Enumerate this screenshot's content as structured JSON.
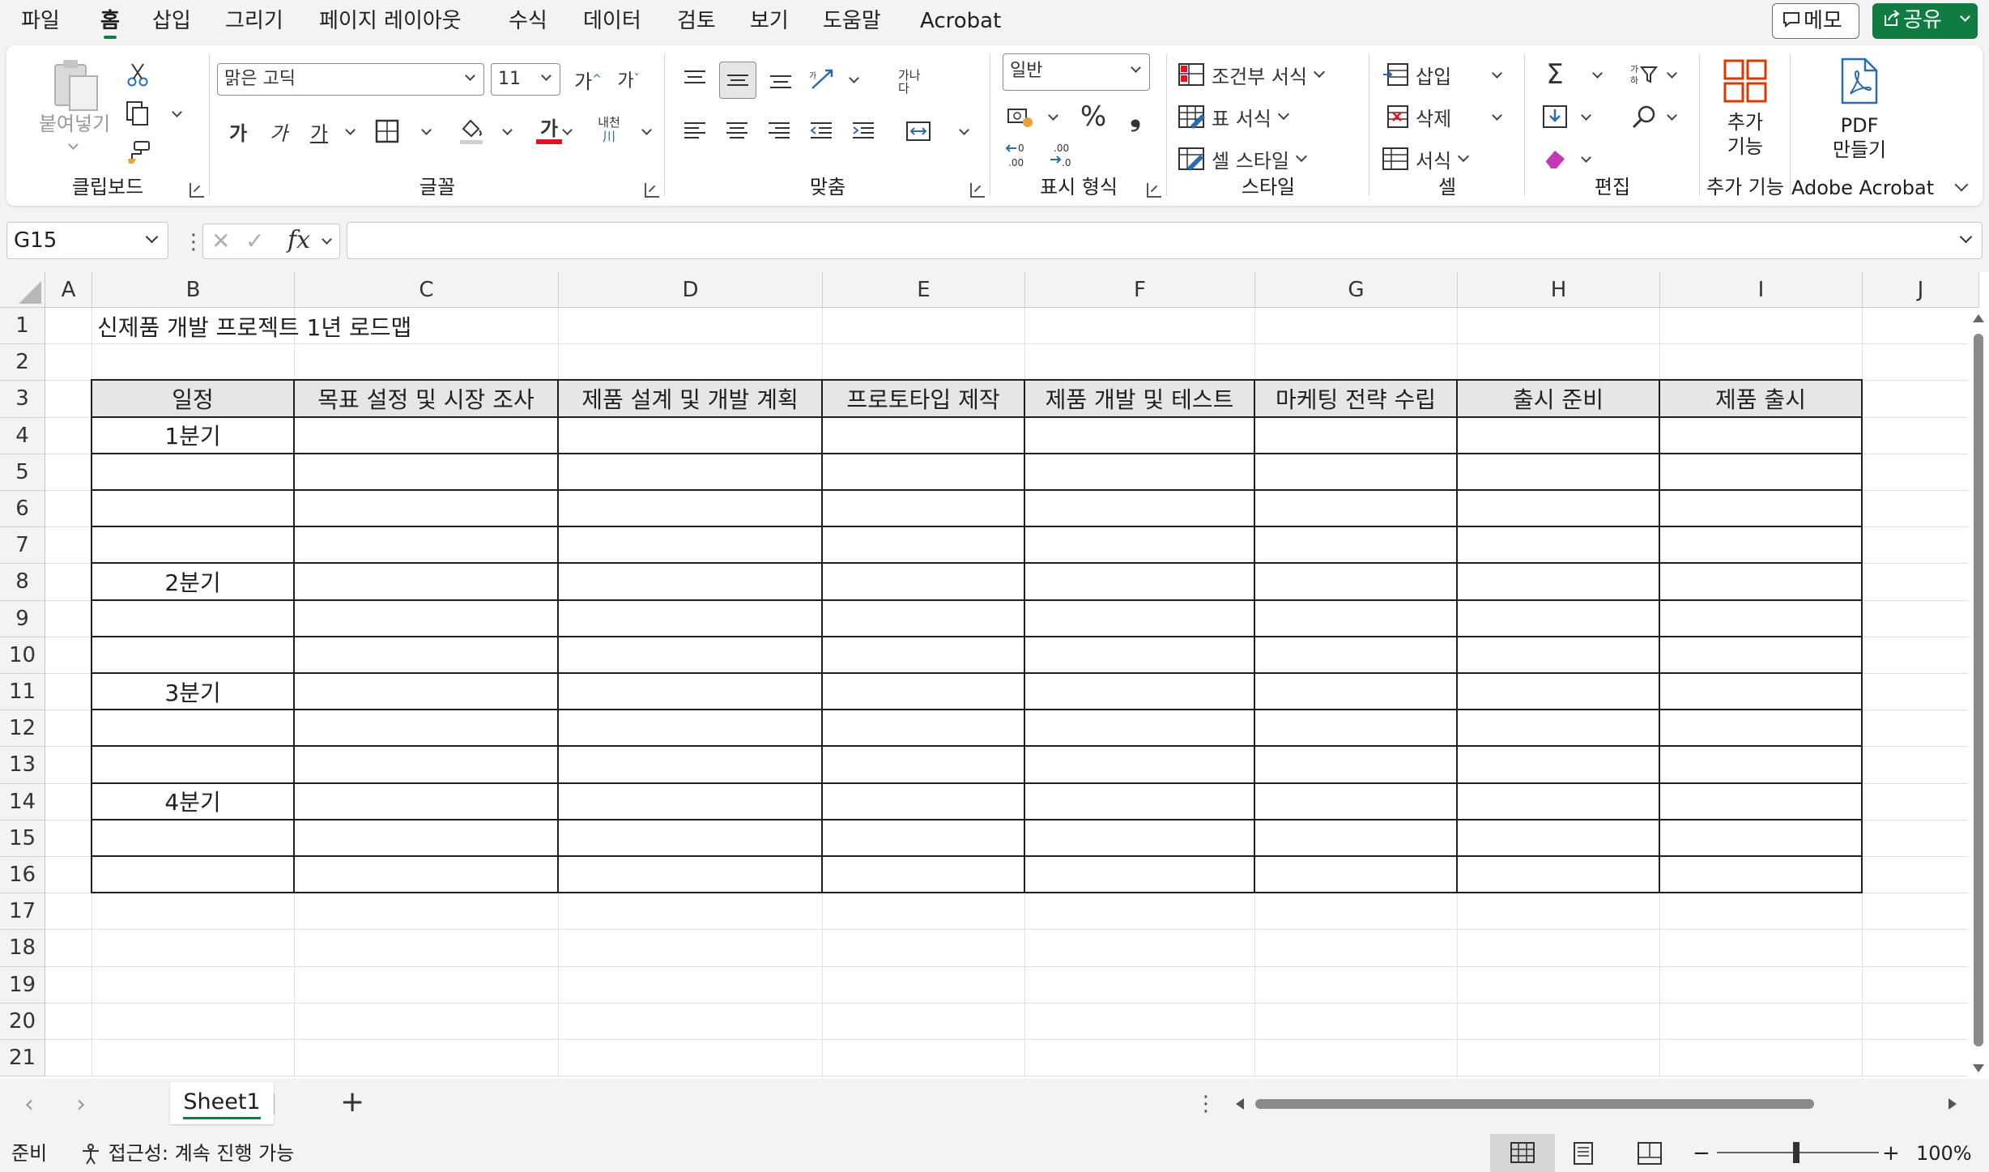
{
  "menu": {
    "tabs": [
      "파일",
      "홈",
      "삽입",
      "그리기",
      "페이지 레이아웃",
      "수식",
      "데이터",
      "검토",
      "보기",
      "도움말",
      "Acrobat"
    ],
    "active_tab": "홈",
    "memo_label": "메모",
    "share_label": "공유"
  },
  "ribbon": {
    "clipboard": {
      "label": "클립보드",
      "paste_label": "붙여넣기"
    },
    "font": {
      "label": "글꼴",
      "font_name": "맑은 고딕",
      "font_size": "11",
      "grow_glyph": "가",
      "shrink_glyph": "가",
      "bold_glyph": "가",
      "italic_glyph": "가",
      "underline_glyph": "가",
      "font_color_glyph": "가",
      "phonetic_glyph": "내천",
      "font_color": "#e81123"
    },
    "alignment": {
      "label": "맞춤",
      "wrap_glyph": "가나다"
    },
    "number": {
      "label": "표시 형식",
      "format": "일반",
      "percent_glyph": "%",
      "comma_glyph": "❟"
    },
    "styles": {
      "label": "스타일",
      "conditional": "조건부 서식",
      "format_table": "표 서식",
      "cell_styles": "셀 스타일"
    },
    "cells": {
      "label": "셀",
      "insert": "삽입",
      "delete": "삭제",
      "format": "서식"
    },
    "editing": {
      "label": "편집",
      "sum_glyph": "Σ"
    },
    "addins": {
      "label": "추가 기능",
      "button": "추가\n기능",
      "button_line1": "추가",
      "button_line2": "기능"
    },
    "acrobat": {
      "label": "Adobe Acrobat",
      "button_line1": "PDF",
      "button_line2": "만들기"
    }
  },
  "formula_bar": {
    "name_box": "G15",
    "fx": "fx",
    "value": ""
  },
  "sheet": {
    "columns": [
      "A",
      "B",
      "C",
      "D",
      "E",
      "F",
      "G",
      "H",
      "I",
      "J"
    ],
    "rows": [
      "1",
      "2",
      "3",
      "4",
      "5",
      "6",
      "7",
      "8",
      "9",
      "10",
      "11",
      "12",
      "13",
      "14",
      "15",
      "16",
      "17",
      "18",
      "19",
      "20",
      "21"
    ],
    "title": "신제품 개발 프로젝트 1년 로드맵",
    "table_headers": [
      "일정",
      "목표 설정 및 시장 조사",
      "제품 설계 및 개발 계획",
      "프로토타입 제작",
      "제품 개발 및 테스트",
      "마케팅 전략 수립",
      "출시 준비",
      "제품 출시"
    ],
    "quarters": [
      "1분기",
      "2분기",
      "3분기",
      "4분기"
    ],
    "header_fill": "#e6e6e6",
    "selected_cell": "G15"
  },
  "sheet_tabs": {
    "tabs": [
      "Sheet1"
    ],
    "add_glyph": "+"
  },
  "status": {
    "ready": "준비",
    "accessibility": "접근성: 계속 진행 가능",
    "zoom": "100%",
    "zoom_minus": "−",
    "zoom_plus": "+"
  },
  "theme": {
    "accent": "#107c41"
  }
}
